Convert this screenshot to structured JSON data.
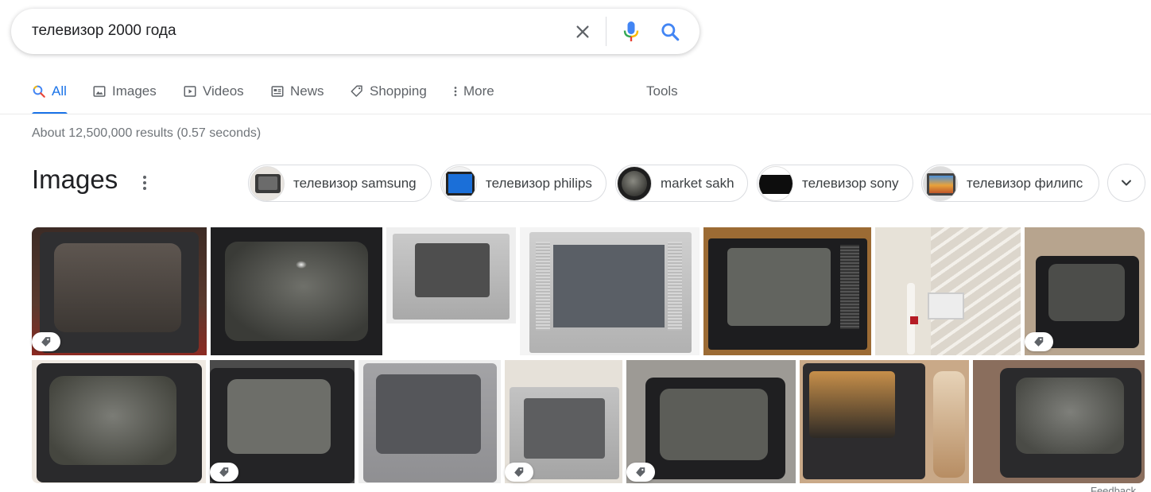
{
  "search": {
    "query": "телевизор 2000 года",
    "clear_icon": "close-icon",
    "mic_icon": "microphone-icon",
    "search_icon": "search-icon"
  },
  "tabs": [
    {
      "label": "All",
      "icon": "search-icon",
      "active": true
    },
    {
      "label": "Images",
      "icon": "image-icon"
    },
    {
      "label": "Videos",
      "icon": "play-icon"
    },
    {
      "label": "News",
      "icon": "news-icon"
    },
    {
      "label": "Shopping",
      "icon": "tag-icon"
    },
    {
      "label": "More",
      "icon": "more-vert-icon"
    },
    {
      "label": "Tools"
    }
  ],
  "result_stats": "About 12,500,000 results (0.57 seconds)",
  "images_section": {
    "heading": "Images",
    "chips": [
      {
        "label": "телевизор samsung"
      },
      {
        "label": "телевизор philips"
      },
      {
        "label": "market sakh"
      },
      {
        "label": "телевизор sony"
      },
      {
        "label": "телевизор филипс"
      }
    ],
    "expand_icon": "chevron-down-icon"
  },
  "footer": {
    "feedback_label": "Feedback"
  },
  "colors": {
    "accent_blue": "#1a73e8",
    "muted_text": "#70757a",
    "tab_text": "#5f6368"
  }
}
